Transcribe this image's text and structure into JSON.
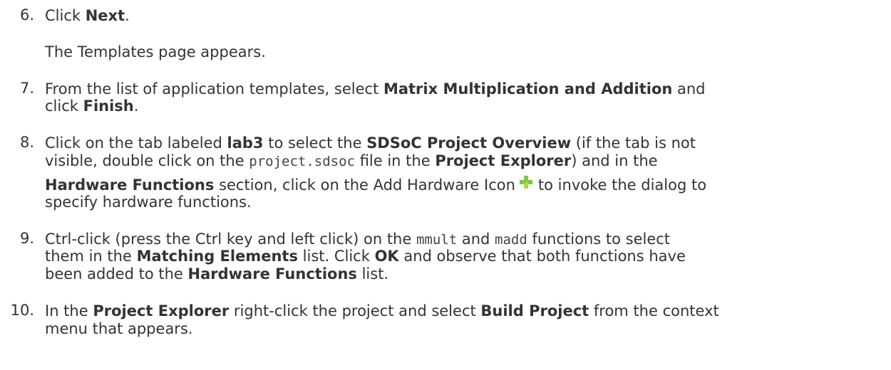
{
  "steps": [
    {
      "number": "6.",
      "parts": [
        [
          "Click ",
          false
        ],
        [
          "Next",
          true
        ],
        [
          ".",
          false
        ]
      ],
      "note": "The Templates page appears."
    },
    {
      "number": "7.",
      "line1": [
        [
          "From the list of application templates, select ",
          false
        ],
        [
          "Matrix Multiplication and Addition",
          true
        ],
        [
          " and",
          false
        ]
      ],
      "line2": [
        [
          "click ",
          false
        ],
        [
          "Finish",
          true
        ],
        [
          ".",
          false
        ]
      ]
    },
    {
      "number": "8.",
      "line1": [
        [
          "Click on the tab labeled ",
          false
        ],
        [
          "lab3",
          true
        ],
        [
          " to select the ",
          false
        ],
        [
          "SDSoC Project Overview",
          true
        ],
        [
          " (if the tab is not",
          false
        ]
      ],
      "line2_pre": "visible, double click on the ",
      "line2_code": "project.sdsoc",
      "line2_mid": " file in the ",
      "line2_bold": "Project Explorer",
      "line2_post": ") and in the",
      "line3_bold": "Hardware Functions",
      "line3_text": " section, click on the Add Hardware Icon",
      "line3_post": "to invoke the dialog to",
      "line4": "specify hardware functions."
    },
    {
      "number": "9.",
      "line1_pre": "Ctrl-click (press the Ctrl key and left click) on the ",
      "line1_code1": "mmult",
      "line1_mid": " and ",
      "line1_code2": "madd",
      "line1_post": " functions to select",
      "line2": [
        [
          "them in the ",
          false
        ],
        [
          "Matching Elements",
          true
        ],
        [
          " list. Click ",
          false
        ],
        [
          "OK",
          true
        ],
        [
          " and observe that both functions have",
          false
        ]
      ],
      "line3": [
        [
          "been added to the ",
          false
        ],
        [
          "Hardware Functions",
          true
        ],
        [
          " list.",
          false
        ]
      ]
    },
    {
      "number": "10.",
      "line1": [
        [
          "In the ",
          false
        ],
        [
          "Project Explorer",
          true
        ],
        [
          " right-click the project and select ",
          false
        ],
        [
          "Build Project",
          true
        ],
        [
          " from the context",
          false
        ]
      ],
      "line2": "menu that appears."
    }
  ],
  "colors": {
    "text": "#333333",
    "icon_green": "#7ac943",
    "icon_yellow": "#f5d547"
  },
  "icons": [
    "add-hardware-icon"
  ]
}
